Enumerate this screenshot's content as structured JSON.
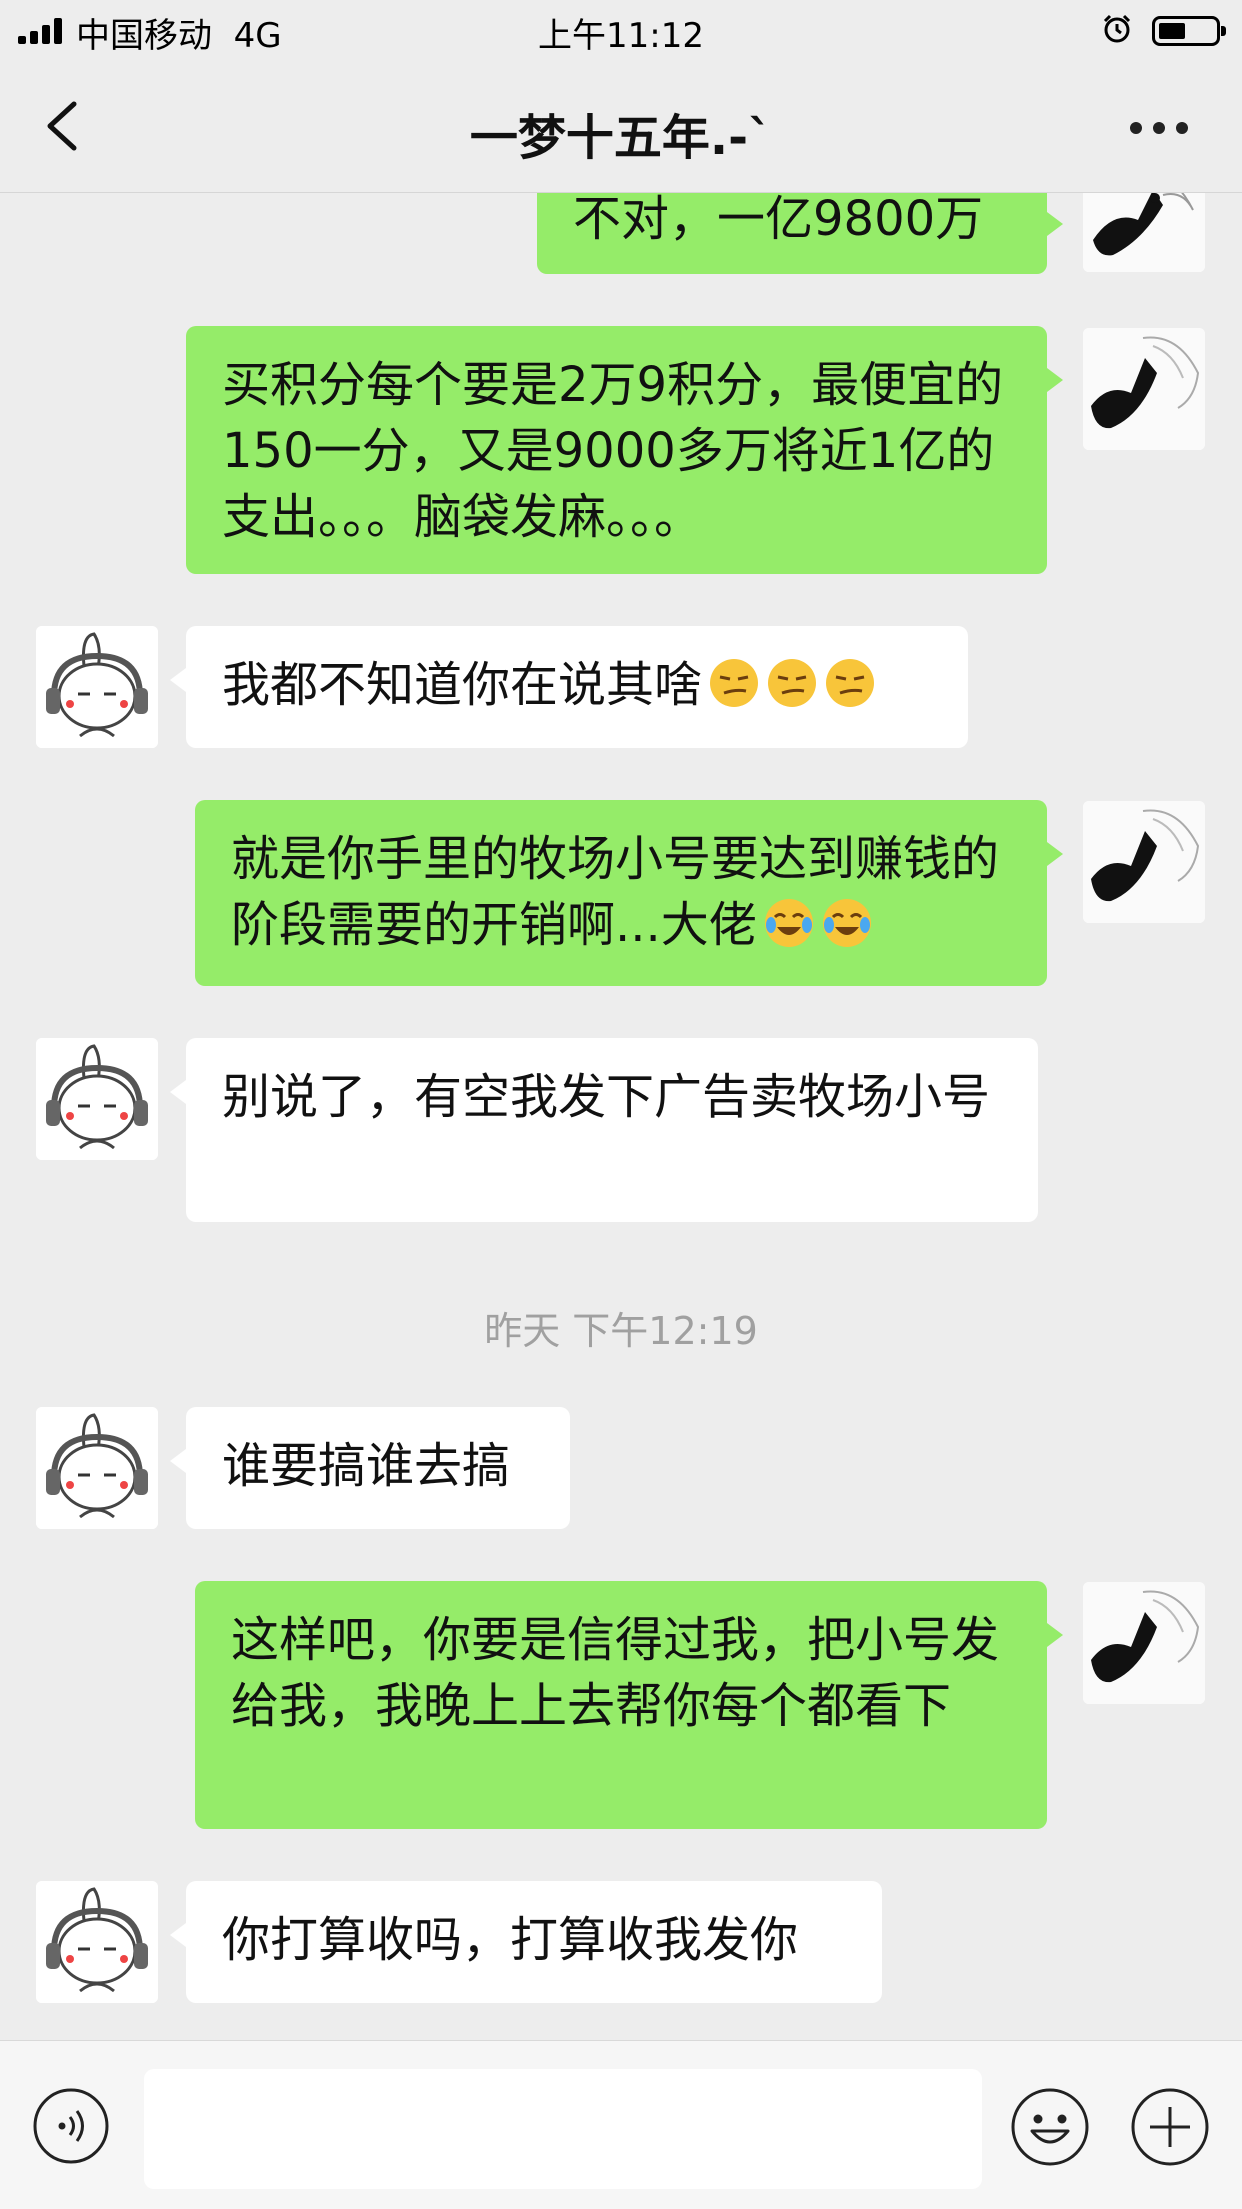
{
  "status_bar": {
    "carrier": "中国移动",
    "network": "4G",
    "time": "上午11:12"
  },
  "header": {
    "title": "一梦十五年.-`"
  },
  "messages": [
    {
      "side": "me",
      "text": "不对，一亿9800万"
    },
    {
      "side": "me",
      "text": "买积分每个要是2万9积分，最便宜的150一分，又是9000多万将近1亿的支出。。。脑袋发麻。。。"
    },
    {
      "side": "them",
      "text": "我都不知道你在说其啥",
      "emojis": [
        "smirk-emoji",
        "smirk-emoji",
        "smirk-emoji"
      ]
    },
    {
      "side": "me",
      "text": "就是你手里的牧场小号要达到赚钱的阶段需要的开销啊...大佬",
      "emojis": [
        "tears-of-joy-emoji",
        "tears-of-joy-emoji"
      ]
    },
    {
      "side": "them",
      "text": "别说了，有空我发下广告卖牧场小号"
    },
    {
      "side": "them",
      "text": "谁要搞谁去搞"
    },
    {
      "side": "me",
      "text": "这样吧，你要是信得过我，把小号发给我，我晚上上去帮你每个都看下"
    },
    {
      "side": "them",
      "text": "你打算收吗，打算收我发你"
    }
  ],
  "timestamp": "昨天 下午12:19",
  "input_bar": {
    "placeholder": ""
  },
  "colors": {
    "my_bubble": "#95ec69",
    "their_bubble": "#ffffff",
    "background": "#ededed"
  }
}
